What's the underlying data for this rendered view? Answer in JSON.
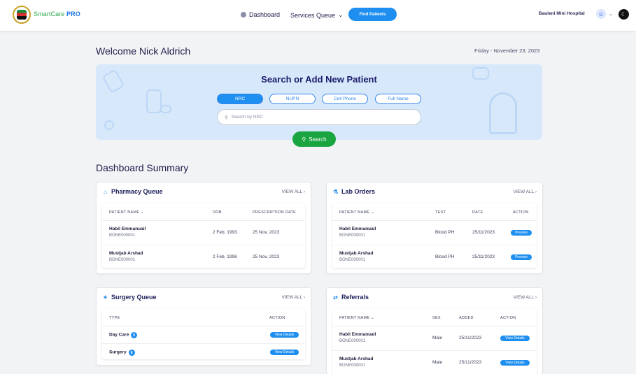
{
  "header": {
    "brand_a": "SmartCare",
    "brand_b": "PRO",
    "nav_dashboard": "Dashboard",
    "nav_services": "Services Queue",
    "find_patients": "Find Patients",
    "hospital": "Bauleni Mini Hospital"
  },
  "welcome": "Welcome Nick Aldrich",
  "date": "Friday - November 23, 2023",
  "search": {
    "title": "Search or Add New Patient",
    "options": [
      "NRC",
      "NUPN",
      "Cell Phone",
      "Full Name"
    ],
    "selected": "NRC",
    "placeholder": "Search by NRC",
    "button": "Search"
  },
  "summary_title": "Dashboard Summary",
  "pharmacy": {
    "title": "Pharmacy Queue",
    "view_all": "VIEW ALL",
    "columns": [
      "PATIENT NAME",
      "DOB",
      "PRESCRIPTION DATE"
    ],
    "rows": [
      {
        "name": "Habil Emmanuail",
        "id": "BONE000001",
        "dob": "2 Feb, 1993",
        "date": "25 Nov, 2023"
      },
      {
        "name": "Mustjab Arshad",
        "id": "BONE000001",
        "dob": "2 Feb, 1996",
        "date": "25 Nov, 2023"
      }
    ]
  },
  "lab": {
    "title": "Lab Orders",
    "view_all": "VIEW ALL",
    "columns": [
      "PATIENT NAME",
      "TEST",
      "DATE",
      "ACTION"
    ],
    "rows": [
      {
        "name": "Habil Emmanuail",
        "id": "BONE000001",
        "test": "Blood PH",
        "date": "25/11/2023",
        "action": "Preview"
      },
      {
        "name": "Mustjab Arshad",
        "id": "BONE000001",
        "test": "Blood PH",
        "date": "25/11/2023",
        "action": "Preview"
      }
    ]
  },
  "surgery": {
    "title": "Surgery Queue",
    "view_all": "VIEW ALL",
    "columns": [
      "TYPE",
      "ACTION"
    ],
    "rows": [
      {
        "type": "Day Care",
        "count": "5",
        "action": "View Details"
      },
      {
        "type": "Surgery",
        "count": "8",
        "action": "View Details"
      }
    ]
  },
  "referrals": {
    "title": "Referrals",
    "view_all": "VIEW ALL",
    "columns": [
      "PATIENT NAME",
      "SEX",
      "ADDED",
      "ACTION"
    ],
    "rows": [
      {
        "name": "Habil Emmanuail",
        "id": "BONE000001",
        "sex": "Male",
        "added": "25/11/2023",
        "action": "View Details"
      },
      {
        "name": "Mustjab Arshad",
        "id": "BONE000001",
        "sex": "Male",
        "added": "25/11/2023",
        "action": "View Details"
      }
    ]
  },
  "colors": {
    "primary": "#1e8ef0",
    "success": "#1aa541",
    "panel": "#d7e8fb",
    "title": "#1c1c6a"
  }
}
